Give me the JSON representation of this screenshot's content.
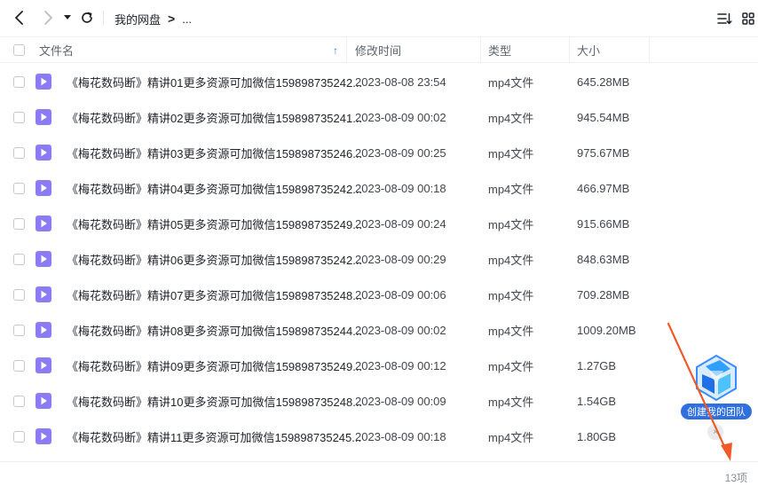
{
  "nav": {
    "back_icon": "chevron-left-icon",
    "forward_icon": "chevron-right-icon",
    "history_icon": "caret-down-icon",
    "refresh_icon": "refresh-icon",
    "breadcrumb_root": "我的网盘",
    "breadcrumb_chevron": ">",
    "breadcrumb_more": "...",
    "sort_icon": "sort-list-icon",
    "grid_icon": "grid-view-icon"
  },
  "table": {
    "columns": {
      "name": "文件名",
      "modified": "修改时间",
      "type": "类型",
      "size": "大小"
    },
    "sort_indicator": "↑",
    "rows": [
      {
        "name": "《梅花数码断》精讲01更多资源可加微信159898735242...",
        "modified": "2023-08-08 23:54",
        "type": "mp4文件",
        "size": "645.28MB"
      },
      {
        "name": "《梅花数码断》精讲02更多资源可加微信159898735241...",
        "modified": "2023-08-09 00:02",
        "type": "mp4文件",
        "size": "945.54MB"
      },
      {
        "name": "《梅花数码断》精讲03更多资源可加微信159898735246...",
        "modified": "2023-08-09 00:25",
        "type": "mp4文件",
        "size": "975.67MB"
      },
      {
        "name": "《梅花数码断》精讲04更多资源可加微信159898735242...",
        "modified": "2023-08-09 00:18",
        "type": "mp4文件",
        "size": "466.97MB"
      },
      {
        "name": "《梅花数码断》精讲05更多资源可加微信159898735249...",
        "modified": "2023-08-09 00:24",
        "type": "mp4文件",
        "size": "915.66MB"
      },
      {
        "name": "《梅花数码断》精讲06更多资源可加微信159898735242...",
        "modified": "2023-08-09 00:29",
        "type": "mp4文件",
        "size": "848.63MB"
      },
      {
        "name": "《梅花数码断》精讲07更多资源可加微信159898735248...",
        "modified": "2023-08-09 00:06",
        "type": "mp4文件",
        "size": "709.28MB"
      },
      {
        "name": "《梅花数码断》精讲08更多资源可加微信159898735244...",
        "modified": "2023-08-09 00:02",
        "type": "mp4文件",
        "size": "1009.20MB"
      },
      {
        "name": "《梅花数码断》精讲09更多资源可加微信159898735249...",
        "modified": "2023-08-09 00:12",
        "type": "mp4文件",
        "size": "1.27GB"
      },
      {
        "name": "《梅花数码断》精讲10更多资源可加微信159898735248...",
        "modified": "2023-08-09 00:09",
        "type": "mp4文件",
        "size": "1.54GB"
      },
      {
        "name": "《梅花数码断》精讲11更多资源可加微信159898735245...",
        "modified": "2023-08-09 00:18",
        "type": "mp4文件",
        "size": "1.80GB"
      }
    ]
  },
  "footer": {
    "count": "13项"
  },
  "promo": {
    "label": "创建我的团队",
    "close_glyph": "×"
  },
  "colors": {
    "video_icon": "#8b7cf6",
    "accent_blue": "#2f6fe0",
    "annotation_arrow": "#f05a28"
  }
}
